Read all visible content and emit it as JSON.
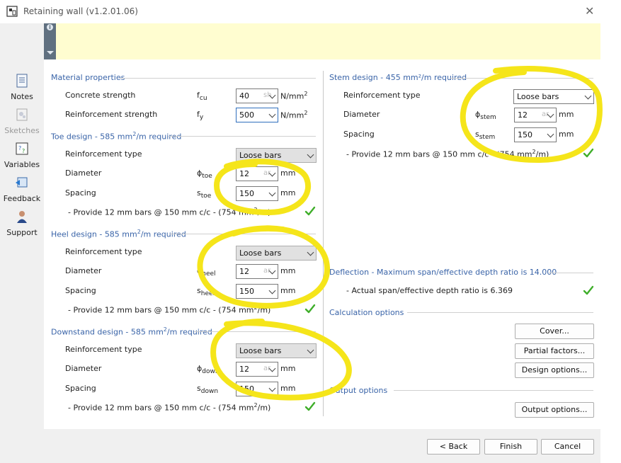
{
  "window": {
    "title": "Retaining wall (v1.2.01.06)"
  },
  "sidebar": {
    "items": [
      {
        "label": "Notes",
        "icon": "notes-icon"
      },
      {
        "label": "Sketches",
        "icon": "sketches-icon"
      },
      {
        "label": "Variables",
        "icon": "variables-icon"
      },
      {
        "label": "Feedback",
        "icon": "feedback-icon"
      },
      {
        "label": "Support",
        "icon": "support-icon"
      }
    ]
  },
  "material": {
    "title": "Material properties",
    "concrete_label": "Concrete strength",
    "concrete_sym": "f",
    "concrete_sub": "cu",
    "concrete_value": "40",
    "concrete_ghost": "sh",
    "concrete_unit": "N/mm",
    "concrete_unit_exp": "2",
    "reinf_label": "Reinforcement strength",
    "reinf_sym": "f",
    "reinf_sub": "y",
    "reinf_value": "500",
    "reinf_unit": "N/mm",
    "reinf_unit_exp": "2"
  },
  "toe": {
    "title_a": "Toe design - 585 mm",
    "title_exp": "2",
    "title_b": "/m required",
    "type_label": "Reinforcement type",
    "type_value": "Loose bars",
    "diam_label": "Diameter",
    "diam_sym": "ϕ",
    "diam_sub": "toe",
    "diam_value": "12",
    "diam_ghost": "ar",
    "diam_unit": "mm",
    "spacing_label": "Spacing",
    "spacing_sym": "s",
    "spacing_sub": "toe",
    "spacing_value": "150",
    "spacing_unit": "mm",
    "msg_a": "- Provide 12 mm bars @ 150 mm c/c - (754 mm",
    "msg_exp": "2",
    "msg_b": "/m)"
  },
  "heel": {
    "title_a": "Heel design - 585 mm",
    "title_exp": "2",
    "title_b": "/m required",
    "type_label": "Reinforcement type",
    "type_value": "Loose bars",
    "diam_label": "Diameter",
    "diam_sym": "ϕ",
    "diam_sub": "heel",
    "diam_value": "12",
    "diam_ghost": "ar",
    "diam_unit": "mm",
    "spacing_label": "Spacing",
    "spacing_sym": "s",
    "spacing_sub": "heel",
    "spacing_value": "150",
    "spacing_unit": "mm",
    "msg_a": "- Provide 12 mm bars @ 150 mm c/c - (754 mm",
    "msg_exp": "2",
    "msg_b": "/m)"
  },
  "downstand": {
    "title_a": "Downstand design - 585 mm",
    "title_exp": "2",
    "title_b": "/m required",
    "type_label": "Reinforcement type",
    "type_value": "Loose bars",
    "diam_label": "Diameter",
    "diam_sym": "ϕ",
    "diam_sub": "down",
    "diam_value": "12",
    "diam_ghost": "ar",
    "diam_unit": "mm",
    "spacing_label": "Spacing",
    "spacing_sym": "s",
    "spacing_sub": "down",
    "spacing_value": "150",
    "spacing_unit": "mm",
    "msg_a": "- Provide 12 mm bars @ 150 mm c/c - (754 mm",
    "msg_exp": "2",
    "msg_b": "/m)"
  },
  "stem": {
    "title": "Stem design - 455 mm²/m required",
    "type_label": "Reinforcement type",
    "type_value": "Loose bars",
    "diam_label": "Diameter",
    "diam_sym": "ϕ",
    "diam_sub": "stem",
    "diam_value": "12",
    "diam_ghost": "ar",
    "diam_unit": "mm",
    "spacing_label": "Spacing",
    "spacing_sym": "s",
    "spacing_sub": "stem",
    "spacing_value": "150",
    "spacing_unit": "mm",
    "msg_a": "- Provide 12 mm bars @ 150 mm c/c - (754 mm",
    "msg_exp": "2",
    "msg_b": "/m)"
  },
  "deflection": {
    "title": "Deflection - Maximum span/effective depth ratio is 14.000",
    "msg": "- Actual span/effective depth ratio is 6.369"
  },
  "calc": {
    "title": "Calculation options",
    "cover": "Cover...",
    "partial": "Partial factors...",
    "design": "Design options..."
  },
  "output": {
    "title": "Output options",
    "button": "Output options..."
  },
  "footer": {
    "back": "< Back",
    "finish": "Finish",
    "cancel": "Cancel"
  },
  "colors": {
    "section_title": "#3a64a8",
    "info_panel": "#fffdd0",
    "highlight": "#f5e51a",
    "check": "#3fae2a"
  }
}
